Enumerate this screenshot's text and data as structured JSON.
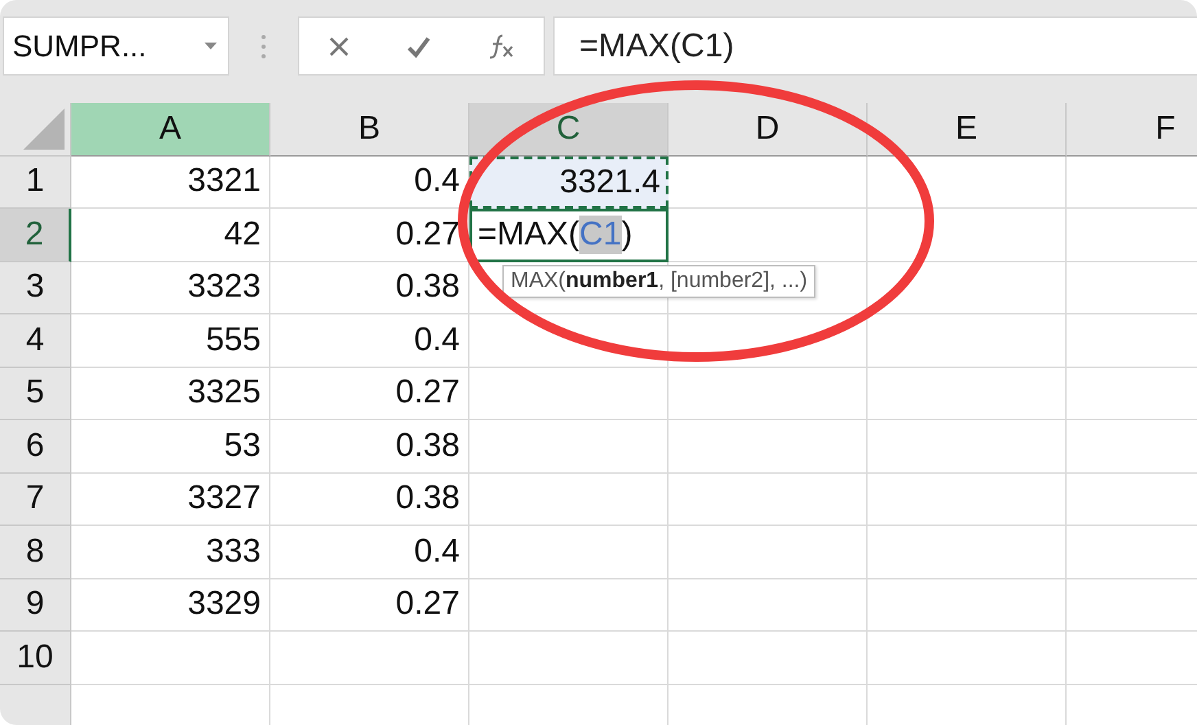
{
  "name_box": {
    "value": "SUMPR..."
  },
  "formula_bar": {
    "value": "=MAX(C1)"
  },
  "columns": [
    {
      "label": "A",
      "selected": true,
      "highlighted": false
    },
    {
      "label": "B",
      "selected": false,
      "highlighted": false
    },
    {
      "label": "C",
      "selected": false,
      "highlighted": true
    },
    {
      "label": "D",
      "selected": false,
      "highlighted": false
    },
    {
      "label": "E",
      "selected": false,
      "highlighted": false
    },
    {
      "label": "F",
      "selected": false,
      "highlighted": false
    }
  ],
  "rows": [
    {
      "header": "1",
      "active": false,
      "cells": [
        {
          "text": "3321",
          "kind": "value"
        },
        {
          "text": "0.4",
          "kind": "value"
        },
        {
          "text": "3321.4",
          "kind": "copied"
        }
      ]
    },
    {
      "header": "2",
      "active": true,
      "cells": [
        {
          "text": "42",
          "kind": "value"
        },
        {
          "text": "0.27",
          "kind": "value"
        },
        {
          "kind": "editing",
          "parts": [
            {
              "text": "=MAX(",
              "kind": "plain"
            },
            {
              "text": "C1",
              "kind": "reference"
            },
            {
              "text": ")",
              "kind": "plain"
            }
          ]
        }
      ]
    },
    {
      "header": "3",
      "active": false,
      "cells": [
        {
          "text": "3323",
          "kind": "value"
        },
        {
          "text": "0.38",
          "kind": "value"
        }
      ]
    },
    {
      "header": "4",
      "active": false,
      "cells": [
        {
          "text": "555",
          "kind": "value"
        },
        {
          "text": "0.4",
          "kind": "value"
        }
      ]
    },
    {
      "header": "5",
      "active": false,
      "cells": [
        {
          "text": "3325",
          "kind": "value"
        },
        {
          "text": "0.27",
          "kind": "value"
        }
      ]
    },
    {
      "header": "6",
      "active": false,
      "cells": [
        {
          "text": "53",
          "kind": "value"
        },
        {
          "text": "0.38",
          "kind": "value"
        }
      ]
    },
    {
      "header": "7",
      "active": false,
      "cells": [
        {
          "text": "3327",
          "kind": "value"
        },
        {
          "text": "0.38",
          "kind": "value"
        }
      ]
    },
    {
      "header": "8",
      "active": false,
      "cells": [
        {
          "text": "333",
          "kind": "value"
        },
        {
          "text": "0.4",
          "kind": "value"
        }
      ]
    },
    {
      "header": "9",
      "active": false,
      "cells": [
        {
          "text": "3329",
          "kind": "value"
        },
        {
          "text": "0.27",
          "kind": "value"
        }
      ]
    },
    {
      "header": "10",
      "active": false,
      "cells": []
    }
  ],
  "tooltip": {
    "text": "MAX(**number1**, [number2], ...)"
  }
}
